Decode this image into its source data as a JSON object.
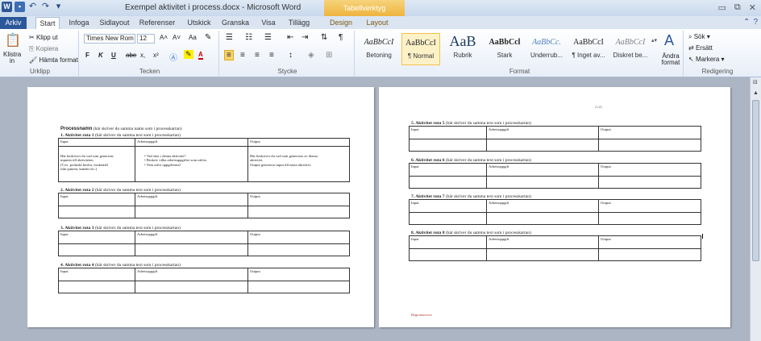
{
  "window": {
    "title": "Exempel aktivitet i process.docx - Microsoft Word",
    "context_group": "Tabellverktyg"
  },
  "tabs": [
    "Arkiv",
    "Start",
    "Infoga",
    "Sidlayout",
    "Referenser",
    "Utskick",
    "Granska",
    "Visa",
    "Tillägg",
    "Design",
    "Layout"
  ],
  "ribbon": {
    "clipboard": {
      "paste": "Klistra in",
      "cut": "Klipp ut",
      "copy": "Kopiera",
      "format_painter": "Hämta format",
      "label": "Urklipp"
    },
    "font": {
      "name": "Times New Rom",
      "size": "12",
      "label": "Tecken",
      "bold": "F",
      "italic": "K",
      "underline": "U",
      "strike": "abe",
      "sub": "x,",
      "sup": "x²",
      "grow": "A˄",
      "shrink": "A˅",
      "case": "Aa",
      "color": "A"
    },
    "paragraph": {
      "label": "Stycke"
    },
    "styles": {
      "label": "Format",
      "items": [
        {
          "sample": "AaBbCcI",
          "name": "Betoning"
        },
        {
          "sample": "AaBbCcI",
          "name": "¶ Normal"
        },
        {
          "sample": "AaB",
          "name": "Rubrik"
        },
        {
          "sample": "AaBbCcl",
          "name": "Stark"
        },
        {
          "sample": "AaBbCc.",
          "name": "Underrub..."
        },
        {
          "sample": "AaBbCcI",
          "name": "¶ Inget av..."
        },
        {
          "sample": "AaBbCcI",
          "name": "Diskret be..."
        }
      ],
      "change": "Ändra format"
    },
    "editing": {
      "label": "Redigering",
      "find": "Sök",
      "replace": "Ersätt",
      "select": "Markera"
    }
  },
  "page1": {
    "heading": "Processnamn",
    "heading_note": "(här skriver du samma namn som i processkartan)",
    "headers": [
      "Input",
      "Arbetsuppgift",
      "Output"
    ],
    "blocks": [
      {
        "title": "1. Aktivitet ruta 1",
        "note": "(här skriver du samma text som i processkartan)"
      },
      {
        "title": "2. Aktivitet ruta 2",
        "note": "(här skriver du samma text som i processkartan)"
      },
      {
        "title": "3. Aktivitet ruta 3",
        "note": "(här skriver du samma text som i processkartan)"
      },
      {
        "title": "4. Aktivitet ruta 4",
        "note": "(här skriver du samma text som i processkartan)"
      }
    ],
    "example": {
      "input": [
        "Här beskriver du vad som genererar",
        "inputen till aktiviteten.",
        "(T.ex. politiskt beslut, önskemål",
        "från patient, kunder etc.)"
      ],
      "task": [
        "Vad sker i denna aktivitet?",
        "Beskriv vilka arbetsuppgifter som utförs.",
        "Vem utför uppgifterna?"
      ],
      "output": [
        "Här beskriver du vad som genereras av denna",
        "aktivitet.",
        "Output genererar input till nästa aktivitet."
      ]
    }
  },
  "page2": {
    "page_number": "2 (2)",
    "headers": [
      "Input",
      "Arbetsuppgift",
      "Output"
    ],
    "blocks": [
      {
        "title": "5. Aktivitet ruta 5",
        "note": "(här skriver du samma text som i processkartan)"
      },
      {
        "title": "6. Aktivitet ruta 6",
        "note": "(här skriver du samma text som i processkartan)"
      },
      {
        "title": "7. Aktivitet ruta 7",
        "note": "(här skriver du samma text som i processkartan)"
      },
      {
        "title": "8. Aktivitet ruta 8",
        "note": "(här skriver du samma text som i processkartan)"
      }
    ],
    "footer": "Regionservice"
  },
  "colors": {
    "file_tab": "#2b579a",
    "context": "#eeb43f",
    "workspace": "#abb5c4"
  }
}
